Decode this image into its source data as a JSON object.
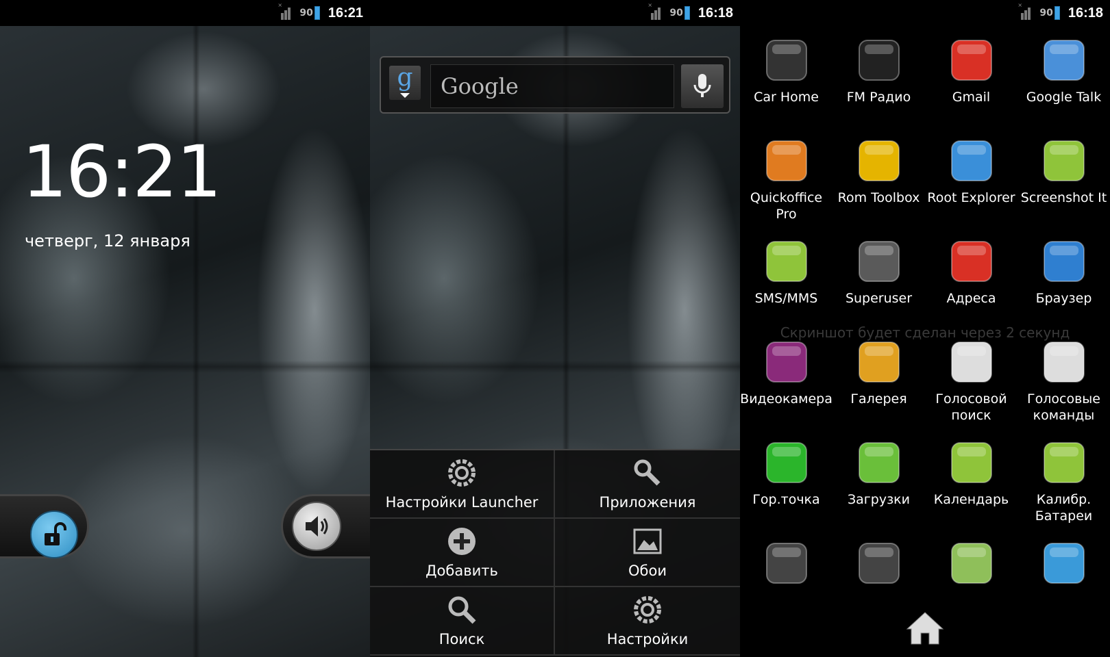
{
  "lock": {
    "status": {
      "battery": "90",
      "time": "16:21"
    },
    "time": "16:21",
    "date": "четверг, 12 января"
  },
  "home": {
    "status": {
      "battery": "90",
      "time": "16:18"
    },
    "search": {
      "placeholder": "Google"
    },
    "menu": [
      {
        "label": "Настройки Launcher",
        "icon": "gear-icon"
      },
      {
        "label": "Приложения",
        "icon": "wrench-icon"
      },
      {
        "label": "Добавить",
        "icon": "plus-icon"
      },
      {
        "label": "Обои",
        "icon": "picture-icon"
      },
      {
        "label": "Поиск",
        "icon": "search-icon"
      },
      {
        "label": "Настройки",
        "icon": "gear-icon"
      }
    ]
  },
  "drawer": {
    "status": {
      "battery": "90",
      "time": "16:18"
    },
    "toast": "Скриншот будет сделан через 2 секунд",
    "apps": [
      {
        "label": "Car Home",
        "icon": "steering-wheel-icon",
        "color": "#333333"
      },
      {
        "label": "FM Радио",
        "icon": "radio-icon",
        "color": "#222222"
      },
      {
        "label": "Gmail",
        "icon": "gmail-icon",
        "color": "#d93025"
      },
      {
        "label": "Google Talk",
        "icon": "talk-icon",
        "color": "#4a90d9"
      },
      {
        "label": "Quickoffice Pro",
        "icon": "quickoffice-icon",
        "color": "#e07b20"
      },
      {
        "label": "Rom Toolbox",
        "icon": "toolbox-icon",
        "color": "#e5b400"
      },
      {
        "label": "Root Explorer",
        "icon": "folder-icon",
        "color": "#3a8fd9"
      },
      {
        "label": "Screenshot It",
        "icon": "android-camera-icon",
        "color": "#8fc43a"
      },
      {
        "label": "SMS/MMS",
        "icon": "sms-icon",
        "color": "#8fc43a"
      },
      {
        "label": "Superuser",
        "icon": "superuser-icon",
        "color": "#5a5a5a"
      },
      {
        "label": "Адреса",
        "icon": "map-pin-icon",
        "color": "#d93025"
      },
      {
        "label": "Браузер",
        "icon": "globe-icon",
        "color": "#2f7fd0"
      },
      {
        "label": "Видеокамера",
        "icon": "video-camera-icon",
        "color": "#8a2a7a"
      },
      {
        "label": "Галерея",
        "icon": "gallery-icon",
        "color": "#e0a020"
      },
      {
        "label": "Голосовой поиск",
        "icon": "microphone-icon",
        "color": "#dddddd"
      },
      {
        "label": "Голосовые команды",
        "icon": "voice-dialer-icon",
        "color": "#dddddd"
      },
      {
        "label": "Гор.точка",
        "icon": "hotspot-icon",
        "color": "#2bb52b"
      },
      {
        "label": "Загрузки",
        "icon": "download-icon",
        "color": "#6abf3a"
      },
      {
        "label": "Календарь",
        "icon": "calendar-icon",
        "color": "#8fc43a"
      },
      {
        "label": "Калибр. Батареи",
        "icon": "android-battery-icon",
        "color": "#8fc43a"
      },
      {
        "label": "",
        "icon": "calculator-icon",
        "color": "#444444"
      },
      {
        "label": "",
        "icon": "camera-icon",
        "color": "#444444"
      },
      {
        "label": "",
        "icon": "maps-icon",
        "color": "#8fbf5a"
      },
      {
        "label": "",
        "icon": "contacts-icon",
        "color": "#3a9ad9"
      }
    ]
  }
}
